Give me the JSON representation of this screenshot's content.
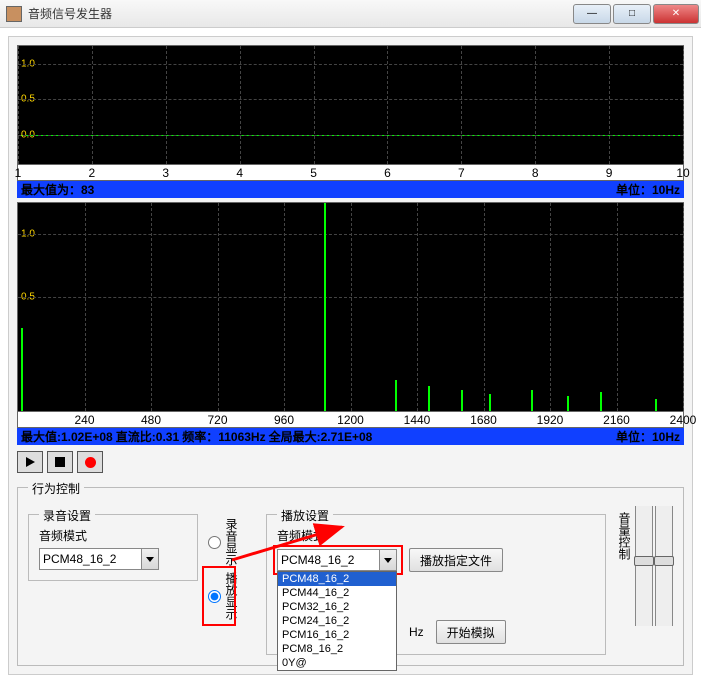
{
  "window": {
    "title": "音频信号发生器"
  },
  "chart_data": [
    {
      "type": "line",
      "ylim": [
        0,
        1.2
      ],
      "ylabels": [
        "1.0",
        "0.5",
        "0.0"
      ],
      "xlim": [
        1,
        10
      ],
      "xticks": [
        1,
        2,
        3,
        4,
        5,
        6,
        7,
        8,
        9,
        10
      ],
      "baseline_y": 0.0,
      "status": {
        "left": "最大值为：83",
        "right": "单位：10Hz"
      }
    },
    {
      "type": "bar",
      "ylim": [
        0,
        1.2
      ],
      "ylabels": [
        "1.0",
        "0.5"
      ],
      "xlim": [
        0,
        2400
      ],
      "xticks": [
        240,
        480,
        720,
        960,
        1200,
        1440,
        1680,
        1920,
        2160,
        2400
      ],
      "spikes": [
        {
          "x": 10,
          "h": 0.4
        },
        {
          "x": 1105,
          "h": 1.0
        },
        {
          "x": 1360,
          "h": 0.15
        },
        {
          "x": 1480,
          "h": 0.12
        },
        {
          "x": 1600,
          "h": 0.1
        },
        {
          "x": 1700,
          "h": 0.08
        },
        {
          "x": 1850,
          "h": 0.1
        },
        {
          "x": 1980,
          "h": 0.07
        },
        {
          "x": 2100,
          "h": 0.09
        },
        {
          "x": 2300,
          "h": 0.06
        }
      ],
      "status": {
        "max": "最大值:1.02E+08",
        "dc": "直流比:0.31",
        "freq": "频率：11063Hz",
        "gmax": "全局最大:2.71E+08",
        "unit": "单位：10Hz"
      }
    }
  ],
  "behavior": {
    "group": "行为控制",
    "record": {
      "group": "录音设置",
      "mode_label": "音频模式",
      "mode_value": "PCM48_16_2",
      "options": [
        "PCM48_16_2"
      ]
    },
    "radios": {
      "rec": "录音显示",
      "play": "播放显示",
      "selected": "play"
    },
    "play": {
      "group": "播放设置",
      "mode_label": "音频模式",
      "mode_value": "PCM48_16_2",
      "options": [
        "PCM48_16_2",
        "PCM44_16_2",
        "PCM32_16_2",
        "PCM24_16_2",
        "PCM16_16_2",
        "PCM8_16_2",
        "0Y@"
      ],
      "file_btn": "播放指定文件",
      "hz_label": "Hz",
      "sim_btn": "开始模拟"
    },
    "volume": {
      "label": "音量控制"
    }
  }
}
